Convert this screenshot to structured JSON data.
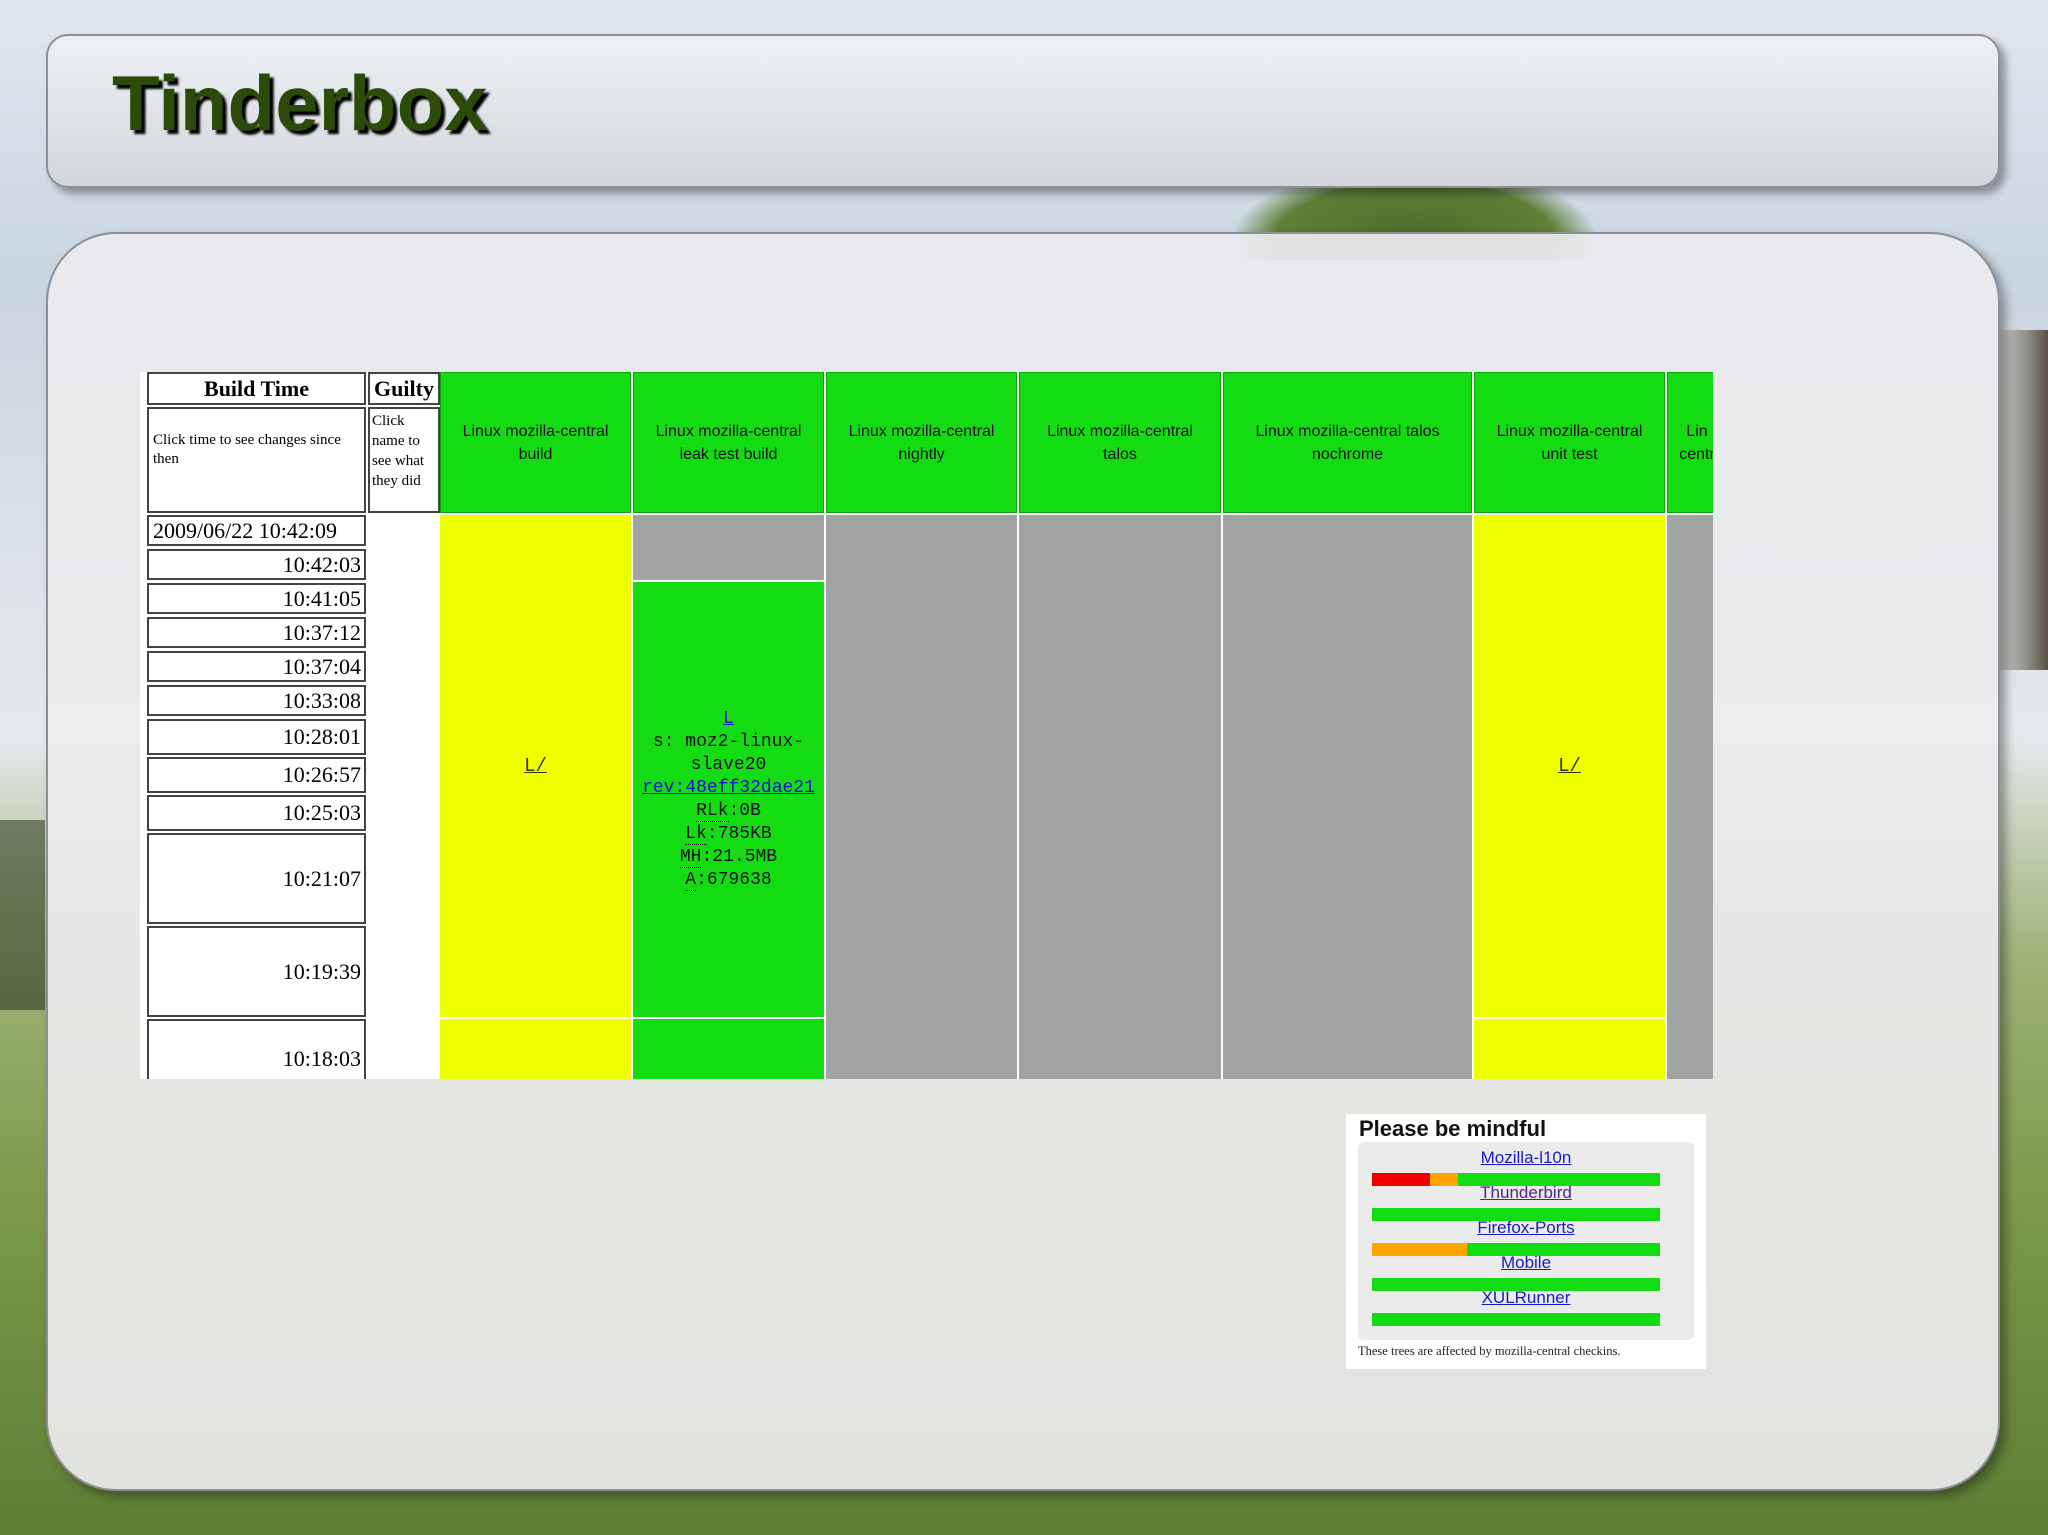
{
  "page": {
    "title": "Tinderbox"
  },
  "table": {
    "build_time_header": "Build Time",
    "build_time_sub": "Click time to see changes since then",
    "guilty_header": "Guilty",
    "guilty_sub": "Click name to see what they did",
    "columns": [
      "Linux mozilla-central build",
      "Linux mozilla-central leak test build",
      "Linux mozilla-central nightly",
      "Linux mozilla-central talos",
      "Linux mozilla-central talos nochrome",
      "Linux mozilla-central unit test",
      "Lin centr"
    ],
    "times": [
      "2009/06/22 10:42:09",
      "10:42:03",
      "10:41:05",
      "10:37:12",
      "10:37:04",
      "10:33:08",
      "10:28:01",
      "10:26:57",
      "10:25:03",
      "10:21:07",
      "10:19:39",
      "10:18:03"
    ],
    "cells": {
      "build_link": "L/",
      "unittest_link": "L/",
      "leak": {
        "log_link": "L",
        "slave": "s: moz2-linux-slave20",
        "rev": "rev:48eff32dae21",
        "rlk_label": "RLk",
        "rlk_value": ":0B",
        "lk_label": "Lk",
        "lk_value": ":785KB",
        "mh_label": "MH",
        "mh_value": ":21.5MB",
        "a_label": "A",
        "a_value": ":679638"
      }
    },
    "colors": {
      "success": "#13dc13",
      "testfailed": "#eeff00",
      "building": "#a2a3a3"
    }
  },
  "mindful": {
    "title": "Please be mindful",
    "trees": [
      {
        "name": "Mozilla-l10n",
        "segments": [
          {
            "color": "#ee0000",
            "fraction": 0.2
          },
          {
            "color": "#ffa500",
            "fraction": 0.1
          },
          {
            "color": "#13dc13",
            "fraction": 0.7
          }
        ]
      },
      {
        "name": "Thunderbird",
        "segments": [
          {
            "color": "#13dc13",
            "fraction": 1.0
          }
        ]
      },
      {
        "name": "Firefox-Ports",
        "segments": [
          {
            "color": "#ffa500",
            "fraction": 0.33
          },
          {
            "color": "#13dc13",
            "fraction": 0.67
          }
        ]
      },
      {
        "name": "Mobile",
        "segments": [
          {
            "color": "#13dc13",
            "fraction": 1.0
          }
        ]
      },
      {
        "name": "XULRunner",
        "segments": [
          {
            "color": "#13dc13",
            "fraction": 1.0
          }
        ]
      }
    ],
    "footer": "These trees are affected by mozilla-central checkins."
  }
}
